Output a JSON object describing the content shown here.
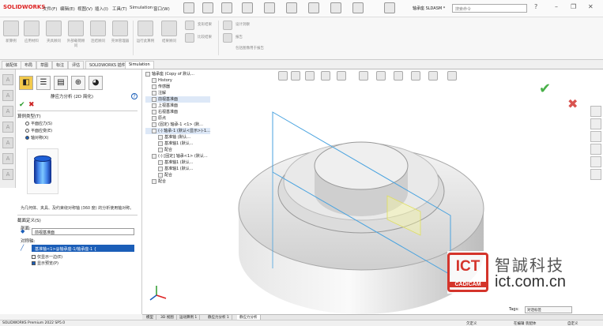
{
  "app": {
    "logo": "SOLIDWORKS"
  },
  "menu": [
    "文件(F)",
    "编辑(E)",
    "视图(V)",
    "插入(I)",
    "工具(T)",
    "Simulation",
    "窗口(W)"
  ],
  "title_text": "轴承座 SLDASM *",
  "search_placeholder": "搜索命令",
  "ribbon": {
    "labels": [
      "新算例",
      "应用材料",
      "夹具顾问",
      "外部载荷顾问",
      "连结顾问",
      "壳体管理器",
      "运行此算例",
      "结果顾问",
      "变形结果",
      "比较结果",
      "设计洞察",
      "报告",
      "包括图像用于报告"
    ]
  },
  "command_tabs": [
    "装配体",
    "布局",
    "草图",
    "标注",
    "评估",
    "SOLIDWORKS 插件",
    "Simulation"
  ],
  "property_manager": {
    "title": "静应力分析 (2D 简化)",
    "section1_title": "算例类型(T)",
    "options": [
      "平面应力(S)",
      "平面应变(E)",
      "轴对称(X)"
    ],
    "selected_option": 2,
    "description": "为几何体、夹具、及约束绕对称轴 (360 度) 的分析使用轴对称。",
    "section2_title": "截面定义(S)",
    "plane_label": "剖面:",
    "plane_value": "前视基准面",
    "axis_label": "对称轴:",
    "axis_value": "基准轴<1>@轴承座-1/轴承座-1 {",
    "checkboxes": [
      {
        "label": "仅显示一边(E)",
        "checked": false
      },
      {
        "label": "显示预览(P)",
        "checked": true
      }
    ]
  },
  "tree": [
    {
      "label": "轴承座 (Copy of 默认...",
      "indent": 0
    },
    {
      "label": "History",
      "indent": 1
    },
    {
      "label": "传感器",
      "indent": 1
    },
    {
      "label": "注解",
      "indent": 1
    },
    {
      "label": "前视基准面",
      "indent": 1,
      "highlight": true
    },
    {
      "label": "上视基准面",
      "indent": 1
    },
    {
      "label": "右视基准面",
      "indent": 1
    },
    {
      "label": "原点",
      "indent": 1
    },
    {
      "label": "(固定) 轴承-1 <1> (默...",
      "indent": 1
    },
    {
      "label": "(-) 轴承-1 (默认<显示>)-1...",
      "indent": 1,
      "highlight": true
    },
    {
      "label": "基准轴 (默认...",
      "indent": 2
    },
    {
      "label": "基准轴1 (默认...",
      "indent": 2
    },
    {
      "label": "配合",
      "indent": 2
    },
    {
      "label": "(-) [固定] 轴承<1> (默认...",
      "indent": 1
    },
    {
      "label": "基准轴1 (默认...",
      "indent": 2
    },
    {
      "label": "基准轴1 (默认...",
      "indent": 2
    },
    {
      "label": "配合",
      "indent": 2
    },
    {
      "label": "配合",
      "indent": 1
    }
  ],
  "brand": {
    "badge": "ICT",
    "badge_sub": "CAD/CAM",
    "name_cn": "智誠科技",
    "url": "ict.com.cn"
  },
  "tag_label": "Tags:",
  "tag_value": "对话标签",
  "model_tabs": [
    "模型",
    "3D 视图",
    "运动算例 1",
    "静应力分析 1",
    "静应力分析"
  ],
  "status": {
    "left": "SOLIDWORKS Premium 2022 SP5.0",
    "center": "欠定义",
    "right": "在编辑 装配体",
    "units": "自定义"
  },
  "colors": {
    "accent": "#1b5eb8",
    "ok": "#49b049",
    "cancel": "#d9534f",
    "brand": "#d4342b"
  }
}
